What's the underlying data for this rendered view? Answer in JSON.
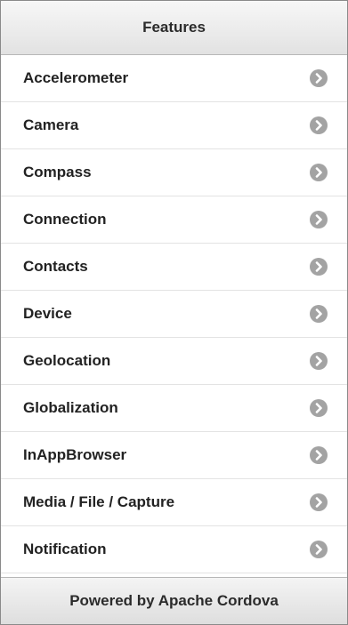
{
  "header": {
    "title": "Features"
  },
  "features": {
    "items": [
      {
        "label": "Accelerometer",
        "icon": "chevron-right-icon"
      },
      {
        "label": "Camera",
        "icon": "chevron-right-icon"
      },
      {
        "label": "Compass",
        "icon": "chevron-right-icon"
      },
      {
        "label": "Connection",
        "icon": "chevron-right-icon"
      },
      {
        "label": "Contacts",
        "icon": "chevron-right-icon"
      },
      {
        "label": "Device",
        "icon": "chevron-right-icon"
      },
      {
        "label": "Geolocation",
        "icon": "chevron-right-icon"
      },
      {
        "label": "Globalization",
        "icon": "chevron-right-icon"
      },
      {
        "label": "InAppBrowser",
        "icon": "chevron-right-icon"
      },
      {
        "label": "Media / File / Capture",
        "icon": "chevron-right-icon"
      },
      {
        "label": "Notification",
        "icon": "chevron-right-icon"
      }
    ]
  },
  "footer": {
    "text": "Powered by Apache Cordova"
  },
  "colors": {
    "chevron_circle": "#a3a3a3",
    "divider": "#e3e3e3",
    "bar_gradient_top": "#f7f7f7",
    "bar_gradient_bottom": "#e2e2e2"
  }
}
